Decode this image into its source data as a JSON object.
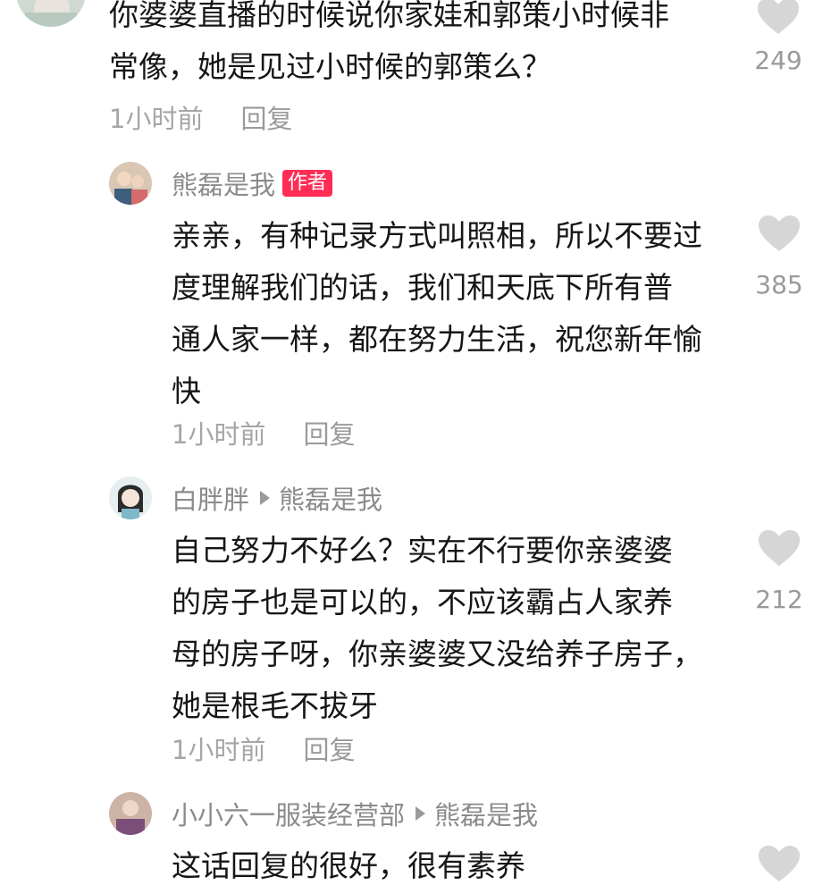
{
  "colors": {
    "author_badge": "#ff2d55",
    "text": "#161616",
    "meta": "#a6a6a6",
    "heart": "#d6d6d6"
  },
  "comments": [
    {
      "author": "",
      "text": "你婆婆直播的时候说你家娃和郭策小时候非\n常像，她是见过小时候的郭策么？",
      "time": "1小时前",
      "reply_label": "回复",
      "likes": "249",
      "icon": "heart-icon"
    },
    {
      "author": "熊磊是我",
      "badge": "作者",
      "text": "亲亲，有种记录方式叫照相，所以不要过\n度理解我们的话，我们和天底下所有普\n通人家一样，都在努力生活，祝您新年愉\n快",
      "time": "1小时前",
      "reply_label": "回复",
      "likes": "385",
      "icon": "heart-icon"
    },
    {
      "author": "白胖胖",
      "reply_to": "熊磊是我",
      "text": "自己努力不好么？实在不行要你亲婆婆\n的房子也是可以的，不应该霸占人家养\n母的房子呀，你亲婆婆又没给养子房子，\n她是根毛不拔牙",
      "time": "1小时前",
      "reply_label": "回复",
      "likes": "212",
      "icon": "heart-icon"
    },
    {
      "author": "小小六一服装经营部",
      "reply_to": "熊磊是我",
      "text": "这话回复的很好，很有素养",
      "icon": "heart-icon"
    }
  ]
}
